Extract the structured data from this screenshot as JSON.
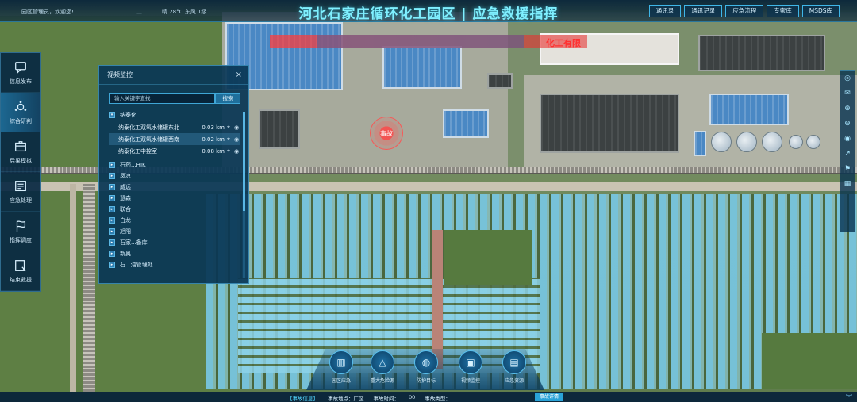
{
  "header": {
    "welcome": "园区管理员，欢迎您!",
    "date": "二",
    "weather": "晴 28°C 东风 1级",
    "title": "河北石家庄循环化工园区 | 应急救援指挥",
    "subtitle": "化工有限",
    "buttons": [
      "通讯录",
      "通讯记录",
      "应急流程",
      "专家库",
      "MSDS库"
    ]
  },
  "nav": {
    "items": [
      {
        "label": "信息发布",
        "icon": "chat-icon"
      },
      {
        "label": "综合研判",
        "icon": "analysis-icon"
      },
      {
        "label": "后果模拟",
        "icon": "simulation-icon"
      },
      {
        "label": "应急处理",
        "icon": "handling-icon"
      },
      {
        "label": "指挥调度",
        "icon": "flag-icon"
      },
      {
        "label": "结束救援",
        "icon": "end-icon"
      }
    ],
    "active_index": 1
  },
  "video_panel": {
    "title": "视频监控",
    "close": "×",
    "search_placeholder": "输入关键字查找",
    "search_button": "搜索",
    "root_node": "纳泰化",
    "leaves": [
      {
        "name": "纳泰化工双氧水储罐东北",
        "dist": "0.03 km"
      },
      {
        "name": "纳泰化工双氧水储罐西南",
        "dist": "0.02 km"
      },
      {
        "name": "纳泰化工中控室",
        "dist": "0.08 km"
      }
    ],
    "groups": [
      "石药...HIK",
      "凤凉",
      "威远",
      "慧森",
      "联合",
      "白龙",
      "旭阳",
      "石家...备库",
      "新奥",
      "石...油管理处"
    ]
  },
  "map": {
    "accident_label": "事故"
  },
  "right_tools": [
    "◎",
    "✉",
    "⊕",
    "⊖",
    "◉",
    "↗",
    "⚑",
    "▦"
  ],
  "dock": [
    {
      "label": "园区应急",
      "icon": "building-icon",
      "glyph": "▥"
    },
    {
      "label": "重大危险源",
      "icon": "warning-icon",
      "glyph": "△"
    },
    {
      "label": "防护目标",
      "icon": "shield-icon",
      "glyph": "◍"
    },
    {
      "label": "视频监控",
      "icon": "camera-icon",
      "glyph": "▣"
    },
    {
      "label": "应急资源",
      "icon": "resource-icon",
      "glyph": "▤"
    }
  ],
  "bottom": {
    "info_header": "【事故信息】",
    "location": "事故地点：厂区",
    "time": "事故时间：",
    "time_suffix": "00",
    "type": "事故类型：",
    "detail_button": "事故详情",
    "expand": "︾"
  }
}
